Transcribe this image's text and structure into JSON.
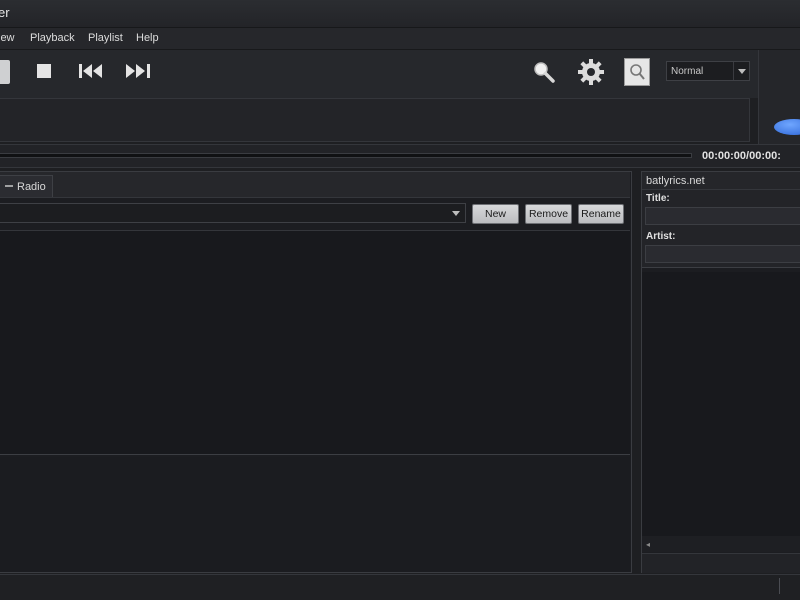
{
  "window": {
    "title": "er"
  },
  "menu": [
    "iew",
    "Playback",
    "Playlist",
    "Help"
  ],
  "toolbar": {
    "mode_value": "Normal",
    "icons": [
      "play-icon",
      "stop-icon",
      "previous-icon",
      "next-icon",
      "search-icon",
      "gear-icon",
      "zoom-icon",
      "chevron-down-icon"
    ]
  },
  "seek": {
    "time": "00:00:00/00:00:"
  },
  "left_panel": {
    "tab_label": "Radio",
    "buttons": {
      "new": "New",
      "remove": "Remove",
      "rename": "Rename"
    }
  },
  "lyrics": {
    "site": "batlyrics.net",
    "title_label": "Title:",
    "artist_label": "Artist:"
  },
  "colors": {
    "accent": "#3a72e0",
    "background": "#1e1f22"
  }
}
